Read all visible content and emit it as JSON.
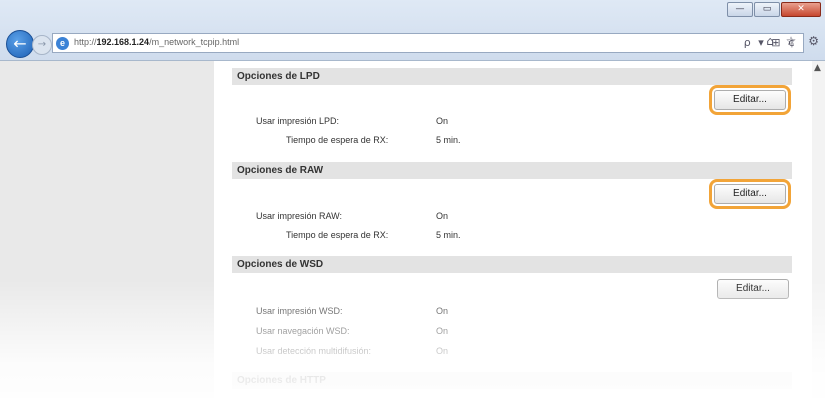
{
  "window": {
    "min_glyph": "—",
    "max_glyph": "▭",
    "close_glyph": "✕"
  },
  "nav": {
    "back_glyph": "←",
    "forward_glyph": "→"
  },
  "address": {
    "url_prefix": "http://",
    "url_host": "192.168.1.24",
    "url_path": "/m_network_tcpip.html",
    "tools": "ρ ▾ ⊞ ¢"
  },
  "toolbar_right": "⌂ ☆ ⚙",
  "scrollbar": {
    "up_glyph": "▲"
  },
  "sections": [
    {
      "title": "Opciones de LPD",
      "edit_label": "Editar...",
      "rows": [
        {
          "label": "Usar impresión LPD:",
          "value": "On"
        },
        {
          "label": "Tiempo de espera de RX:",
          "value": "5 min."
        }
      ]
    },
    {
      "title": "Opciones de RAW",
      "edit_label": "Editar...",
      "rows": [
        {
          "label": "Usar impresión RAW:",
          "value": "On"
        },
        {
          "label": "Tiempo de espera de RX:",
          "value": "5 min."
        }
      ]
    },
    {
      "title": "Opciones de WSD",
      "edit_label": "Editar...",
      "rows": [
        {
          "label": "Usar impresión WSD:",
          "value": "On"
        },
        {
          "label": "Usar navegación WSD:",
          "value": "On"
        },
        {
          "label": "Usar detección multidifusión:",
          "value": "On"
        }
      ]
    },
    {
      "title": "Opciones de HTTP"
    }
  ],
  "colors": {
    "highlight": "#f2a438",
    "header_bg": "#e3e3e3",
    "gutter": "#e9e9e9"
  }
}
